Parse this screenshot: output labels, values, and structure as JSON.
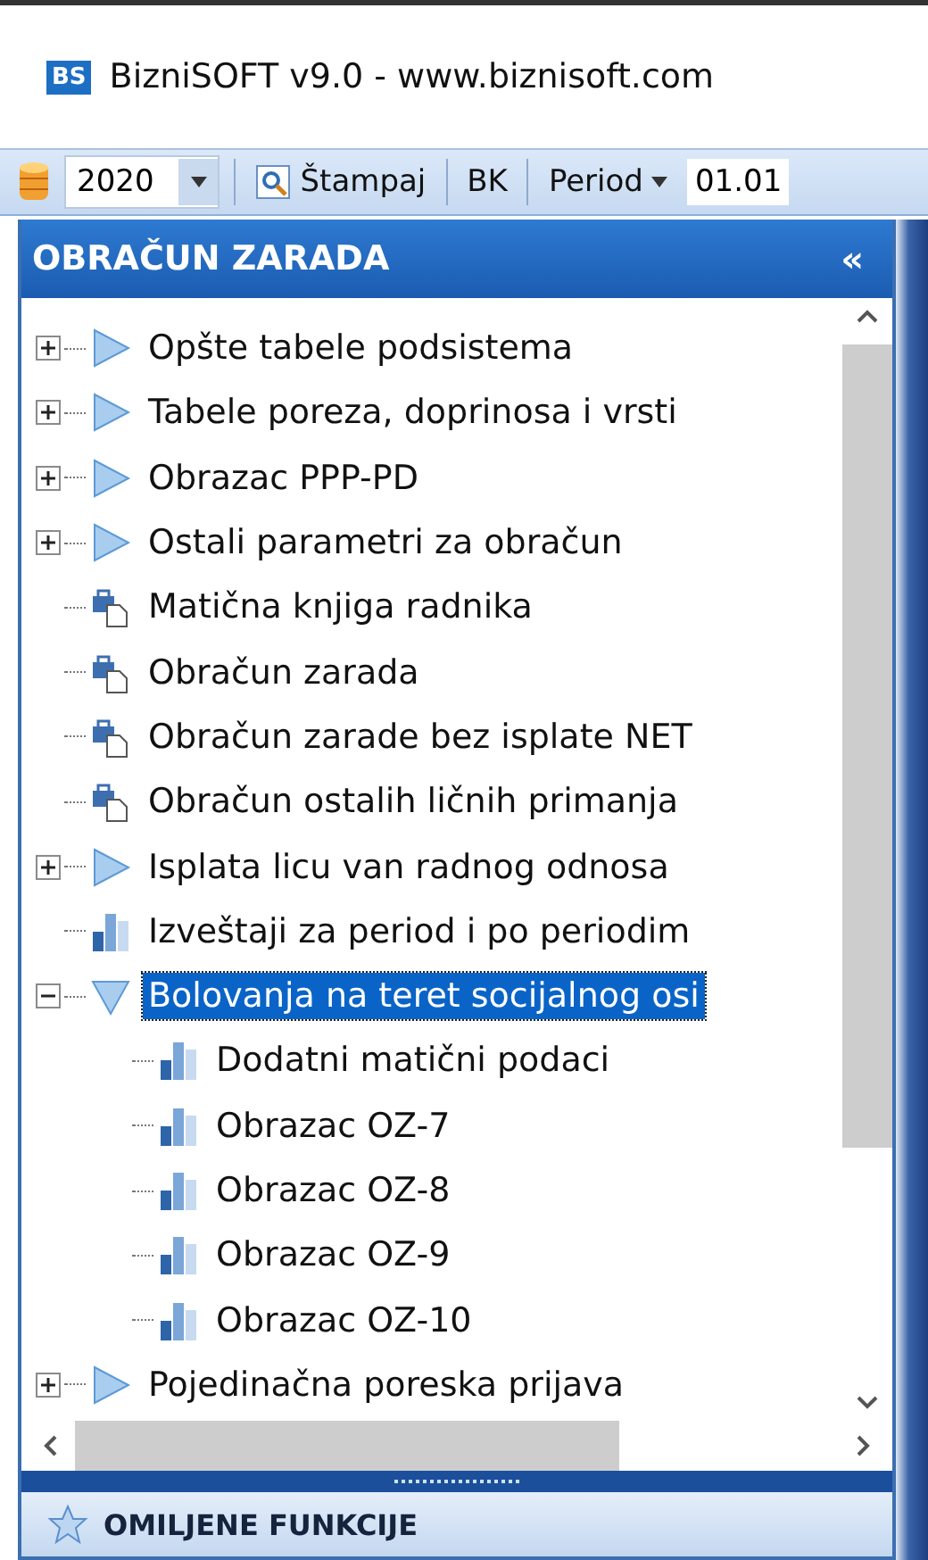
{
  "window": {
    "logo": "BS",
    "title": "BizniSOFT v9.0 - www.biznisoft.com"
  },
  "toolbar": {
    "year": "2020",
    "print_button": "Štampaj",
    "bk_button": "BK",
    "period_button": "Period",
    "date": "01.01"
  },
  "panel": {
    "title": "OBRAČUN ZARADA",
    "collapse": "«"
  },
  "tree": [
    {
      "label": "Opšte tabele podsistema",
      "kind": "folder",
      "expanded": false,
      "selected": false
    },
    {
      "label": "Tabele poreza, doprinosa i vrsti",
      "kind": "folder",
      "expanded": false,
      "selected": false
    },
    {
      "label": "Obrazac PPP-PD",
      "kind": "folder",
      "expanded": false,
      "selected": false
    },
    {
      "label": "Ostali parametri za obračun",
      "kind": "folder",
      "expanded": false,
      "selected": false
    },
    {
      "label": "Matična knjiga radnika",
      "kind": "form",
      "selected": false
    },
    {
      "label": "Obračun zarada",
      "kind": "form",
      "selected": false
    },
    {
      "label": "Obračun zarade bez isplate NET",
      "kind": "form",
      "selected": false
    },
    {
      "label": "Obračun ostalih ličnih primanja",
      "kind": "form",
      "selected": false
    },
    {
      "label": "Isplata licu van radnog odnosa",
      "kind": "folder",
      "expanded": false,
      "selected": false
    },
    {
      "label": "Izveštaji za period i po periodim",
      "kind": "report",
      "selected": false
    },
    {
      "label": "Bolovanja na teret socijalnog osi",
      "kind": "folder",
      "expanded": true,
      "selected": true,
      "children": [
        {
          "label": "Dodatni matični podaci",
          "kind": "report",
          "selected": false
        },
        {
          "label": "Obrazac OZ-7",
          "kind": "report",
          "selected": false
        },
        {
          "label": "Obrazac OZ-8",
          "kind": "report",
          "selected": false
        },
        {
          "label": "Obrazac OZ-9",
          "kind": "report",
          "selected": false
        },
        {
          "label": "Obrazac OZ-10",
          "kind": "report",
          "selected": false
        }
      ]
    },
    {
      "label": "Pojedinačna poreska prijava",
      "kind": "folder",
      "expanded": false,
      "selected": false
    }
  ],
  "favorites": {
    "title": "OMILJENE FUNKCIJE"
  }
}
